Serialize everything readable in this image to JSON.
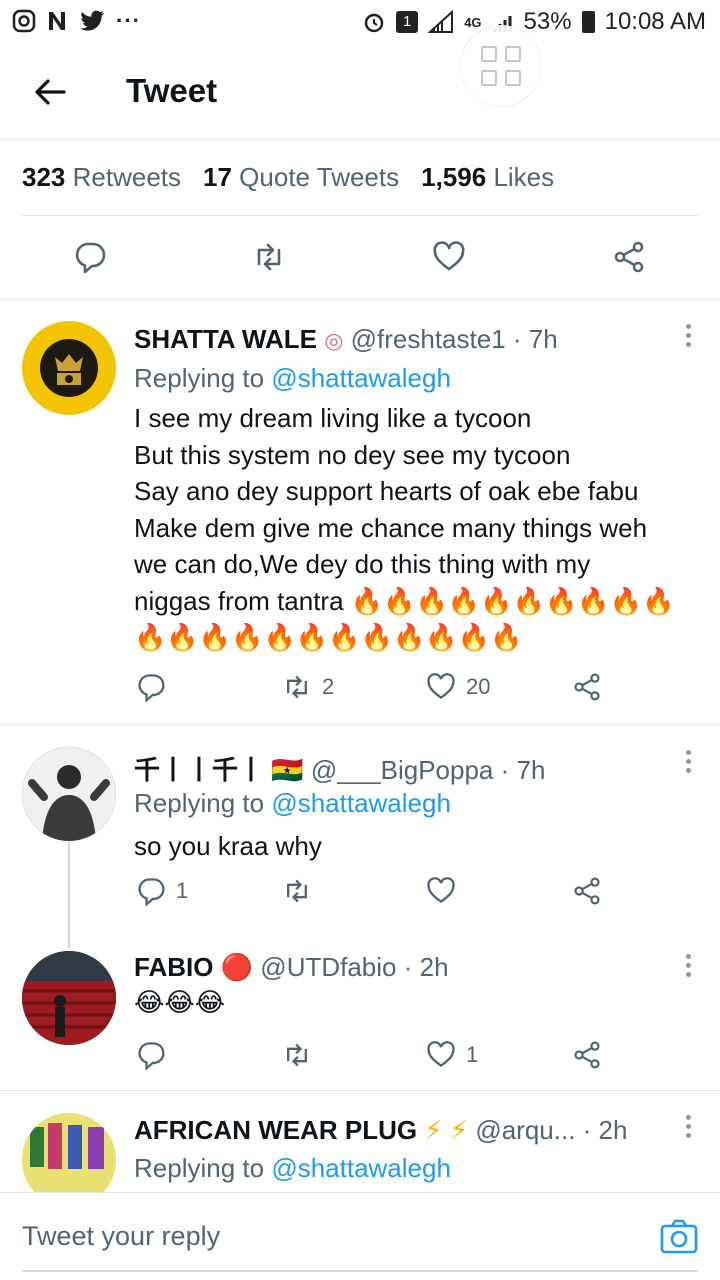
{
  "status_bar": {
    "left_icons": [
      "instagram-icon",
      "news-icon",
      "twitter-icon",
      "more-icon"
    ],
    "left_text": "◎ N ✦ ···",
    "sim_label": "1",
    "network": "4G",
    "battery": "53%",
    "time": "10:08 AM"
  },
  "header": {
    "title": "Tweet"
  },
  "stats": {
    "retweets_count": "323",
    "retweets_label": "Retweets",
    "quotes_count": "17",
    "quotes_label": "Quote Tweets",
    "likes_count": "1,596",
    "likes_label": "Likes"
  },
  "replies": [
    {
      "name": "SHATTA WALE",
      "badge": "◎",
      "handle": "@freshtaste1 · 7h",
      "replying_prefix": "Replying to",
      "replying_to": "@shattawalegh",
      "lines": [
        "I see my dream living like a tycoon",
        "But this system no dey see my tycoon",
        "Say ano dey support hearts of oak ebe fabu",
        "Make dem give me chance many things weh",
        "we can do,We dey do this thing with my",
        "niggas from tantra 🔥🔥🔥🔥🔥🔥🔥🔥🔥🔥",
        "🔥🔥🔥🔥🔥🔥🔥🔥🔥🔥🔥🔥"
      ],
      "reply_count": "",
      "retweet_count": "2",
      "like_count": "20"
    },
    {
      "name": "千丨丨千丨",
      "badge": "🇬🇭",
      "handle": "@___BigPoppa · 7h",
      "replying_prefix": "Replying to",
      "replying_to": "@shattawalegh",
      "text": "so you kraa why",
      "reply_count": "1",
      "retweet_count": "",
      "like_count": ""
    },
    {
      "name": "FABIO",
      "badge": "🔴",
      "handle": "@UTDfabio · 2h",
      "text": "😂😂😂",
      "reply_count": "",
      "retweet_count": "",
      "like_count": "1"
    },
    {
      "name": "AFRICAN WEAR PLUG",
      "badge": "⚡ ⚡",
      "handle": "@arqu... · 2h",
      "replying_prefix": "Replying to",
      "replying_to": "@shattawalegh"
    }
  ],
  "reply_bar": {
    "placeholder": "Tweet your reply"
  },
  "colors": {
    "link": "#1d9bf0",
    "secondary": "#536471",
    "divider": "#e3e6e8",
    "avatar_gold": "#f5c400"
  }
}
